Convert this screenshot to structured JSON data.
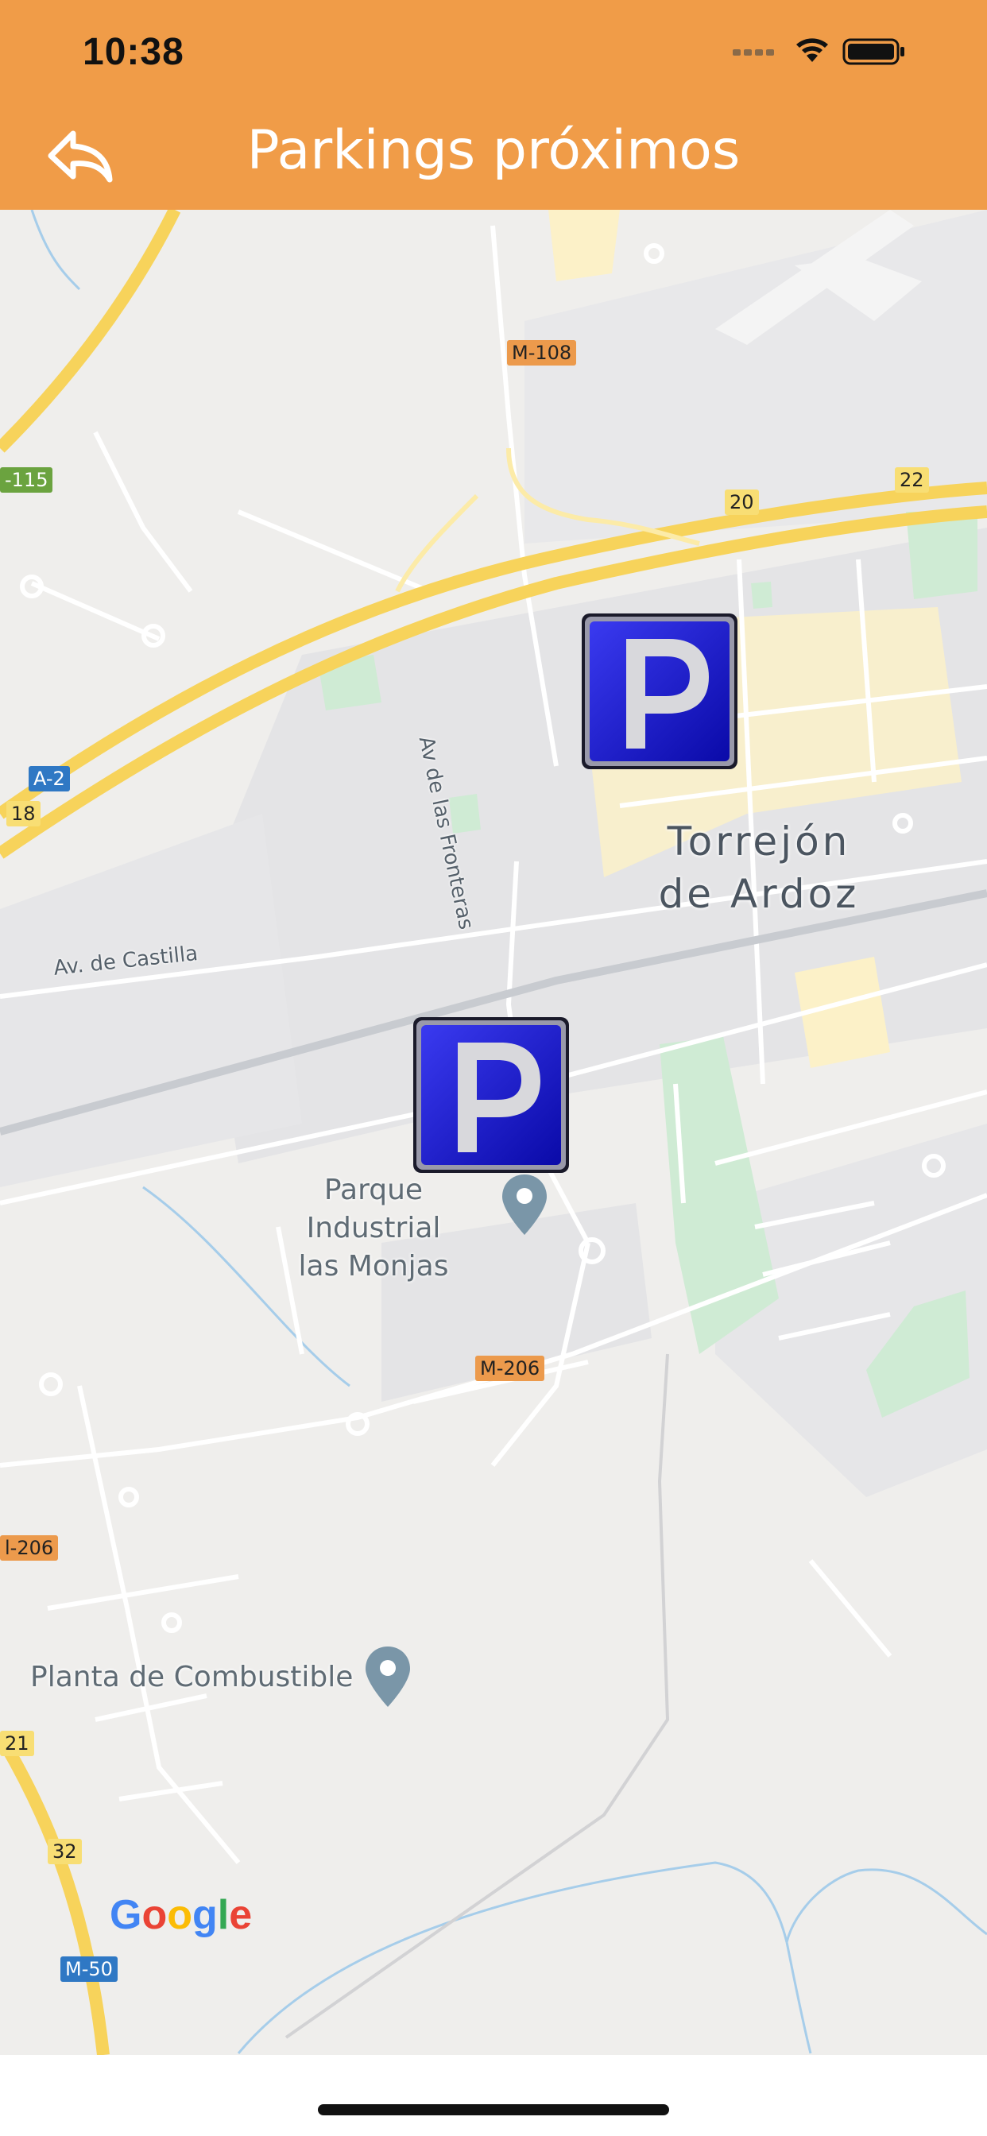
{
  "status_bar": {
    "time": "10:38"
  },
  "header": {
    "title": "Parkings próximos",
    "back_icon": "back-reply-icon"
  },
  "colors": {
    "header": "#F09C48",
    "map_bg": "#EFEEEC",
    "parking": "#1A1ACC"
  },
  "map": {
    "city_label_line1": "Torrejón",
    "city_label_line2": "de Ardoz",
    "street_castilla": "Av. de Castilla",
    "street_fronteras": "Av de las Fronteras",
    "poi_parque_line1": "Parque Industrial",
    "poi_parque_line2": "las Monjas",
    "poi_planta": "Planta de Combustible",
    "shields": {
      "m108": "M-108",
      "m115": "-115",
      "a2": "A-2",
      "n18": "18",
      "n20": "20",
      "n22": "22",
      "m206a": "M-206",
      "m206b": "l-206",
      "n21": "21",
      "n32": "32",
      "m50": "M-50"
    },
    "parking_letter": "P",
    "google_logo": "Google"
  }
}
